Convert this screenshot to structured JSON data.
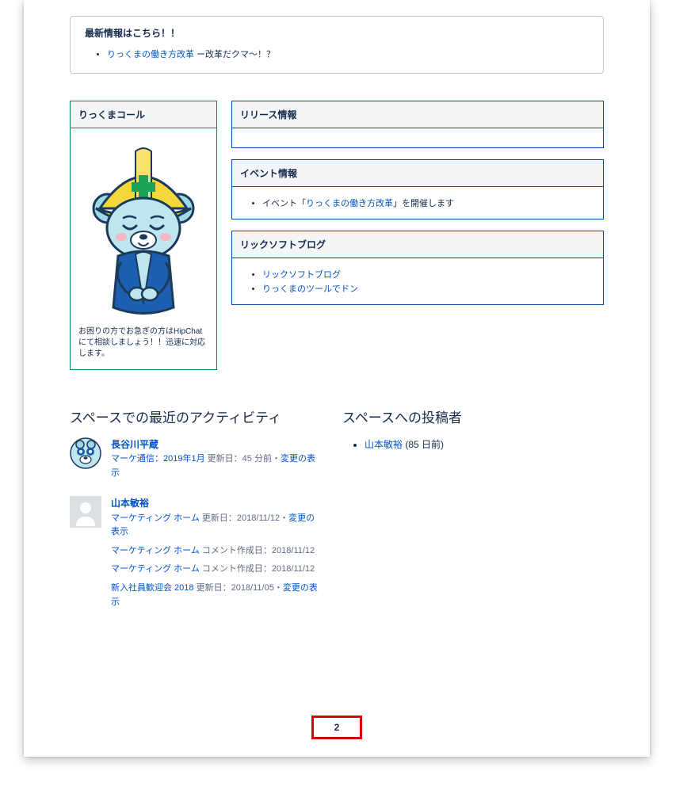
{
  "top_panel": {
    "title": "最新情報はこちら！！",
    "item_link": "りっくまの働き方改革",
    "item_suffix": " ー改革だクマ～！？"
  },
  "rikkuma_call": {
    "title": "りっくまコール",
    "note": "お困りの方でお急ぎの方はHipChatにて相談しましょう！！迅速に対応します。"
  },
  "release": {
    "title": "リリース情報"
  },
  "event": {
    "title": "イベント情報",
    "prefix": "イベント「",
    "link": "りっくまの働き方改革",
    "suffix": "」を開催します"
  },
  "blog": {
    "title": "リックソフトブログ",
    "items": [
      "リックソフトブログ",
      "りっくまのツールでドン"
    ]
  },
  "activity": {
    "heading": "スペースでの最近のアクティビティ",
    "entries": [
      {
        "author": "長谷川平蔵",
        "rows": [
          {
            "link": "マーケ通信：2019年1月",
            "meta": " 更新日：45 分前・",
            "tail_link": "変更の表示"
          }
        ]
      },
      {
        "author": "山本敏裕",
        "rows": [
          {
            "link": "マーケティング ホーム",
            "meta": " 更新日：2018/11/12・",
            "tail_link": "変更の表示"
          },
          {
            "link": "マーケティング ホーム",
            "meta": " コメント作成日：2018/11/12",
            "tail_link": ""
          },
          {
            "link": "マーケティング ホーム",
            "meta": " コメント作成日：2018/11/12",
            "tail_link": ""
          },
          {
            "link": "新入社員歓迎会 2018",
            "meta": " 更新日：2018/11/05・",
            "tail_link": "変更の表示"
          }
        ]
      }
    ]
  },
  "contributors": {
    "heading": "スペースへの投稿者",
    "item_link": "山本敏裕",
    "item_meta": " (85 日前)"
  },
  "page_number": "2"
}
